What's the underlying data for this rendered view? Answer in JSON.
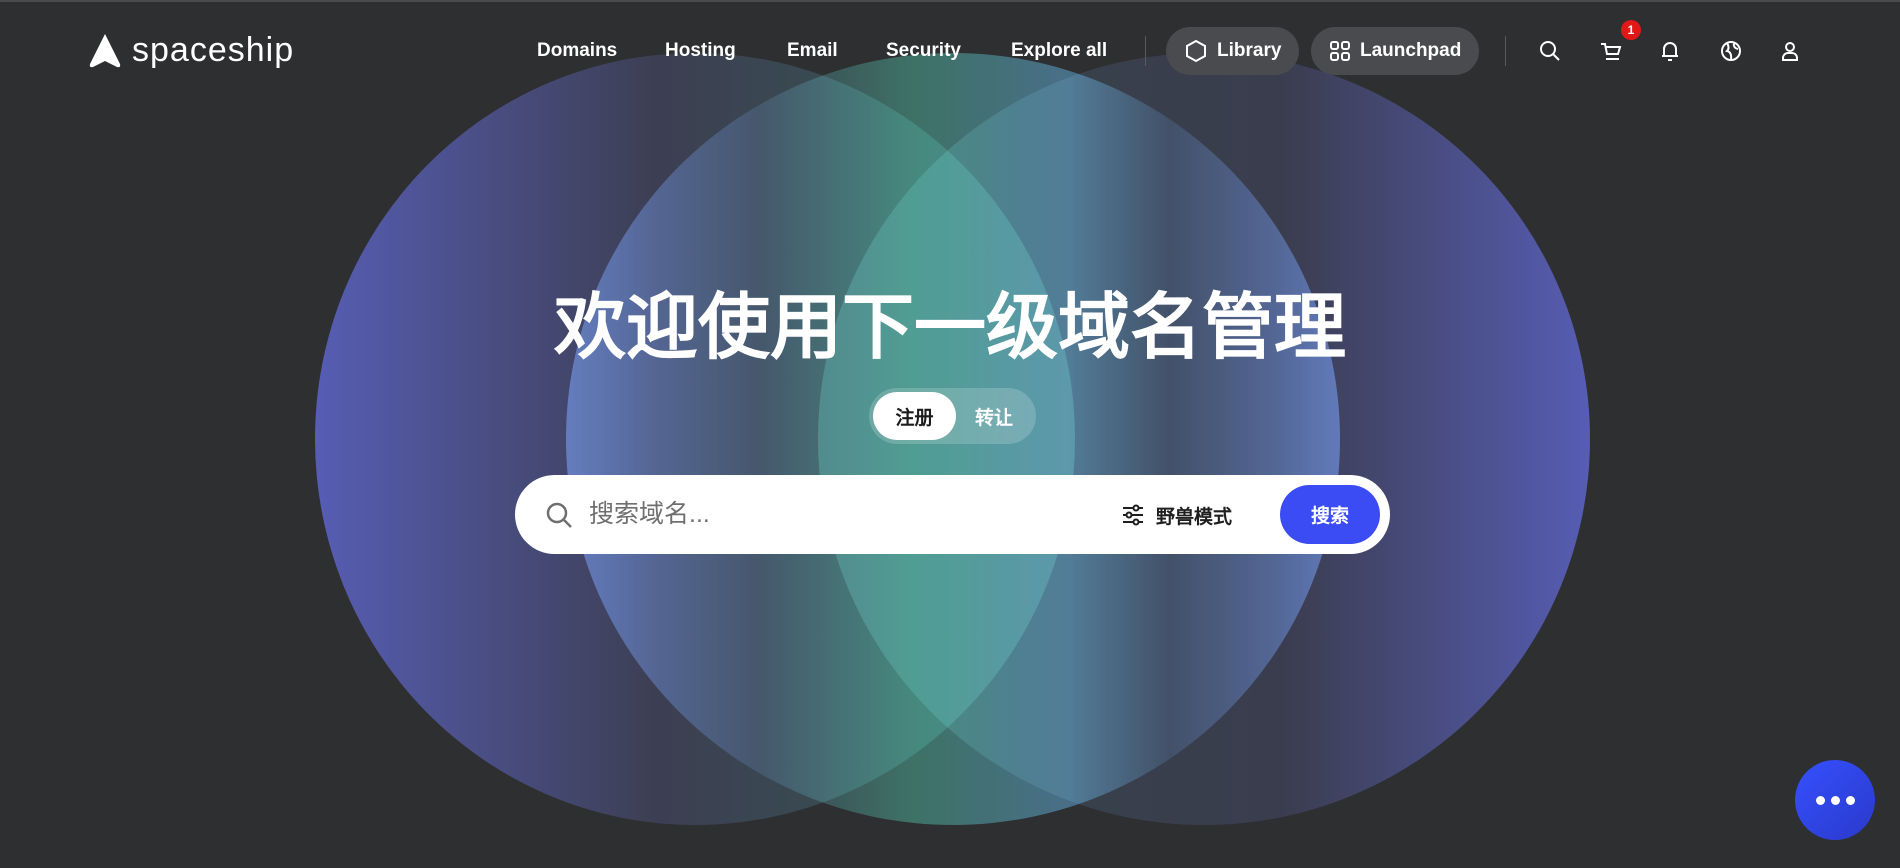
{
  "header": {
    "logo_text": "spaceship",
    "nav": [
      {
        "label": "Domains"
      },
      {
        "label": "Hosting"
      },
      {
        "label": "Email"
      },
      {
        "label": "Security"
      },
      {
        "label": "Explore all"
      }
    ],
    "library_label": "Library",
    "launchpad_label": "Launchpad",
    "cart_count": "1",
    "icons": [
      "search-icon",
      "cart-icon",
      "bell-icon",
      "globe-icon",
      "user-icon"
    ]
  },
  "hero": {
    "title": "欢迎使用下一级域名管理",
    "toggle": {
      "active": "注册",
      "inactive": "转让"
    },
    "search": {
      "placeholder": "搜索域名...",
      "beast_mode": "野兽模式",
      "button": "搜索"
    }
  },
  "colors": {
    "background": "#2e2f31",
    "accent": "#3b4cf5",
    "badge": "#e01818"
  }
}
